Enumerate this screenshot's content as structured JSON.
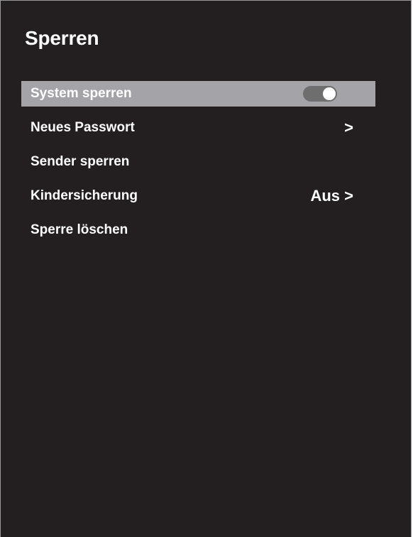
{
  "page": {
    "title": "Sperren"
  },
  "menu": {
    "items": [
      {
        "label": "System sperren",
        "control": "toggle",
        "toggle_on": true,
        "selected": true
      },
      {
        "label": "Neues Passwort",
        "value": ">"
      },
      {
        "label": "Sender sperren"
      },
      {
        "label": "Kindersicherung",
        "value": "Aus >"
      },
      {
        "label": "Sperre löschen"
      }
    ]
  },
  "colors": {
    "background": "#231f20",
    "selection": "#a4a3a8",
    "text": "#ffffff",
    "toggle_track": "#6e6e6e"
  }
}
